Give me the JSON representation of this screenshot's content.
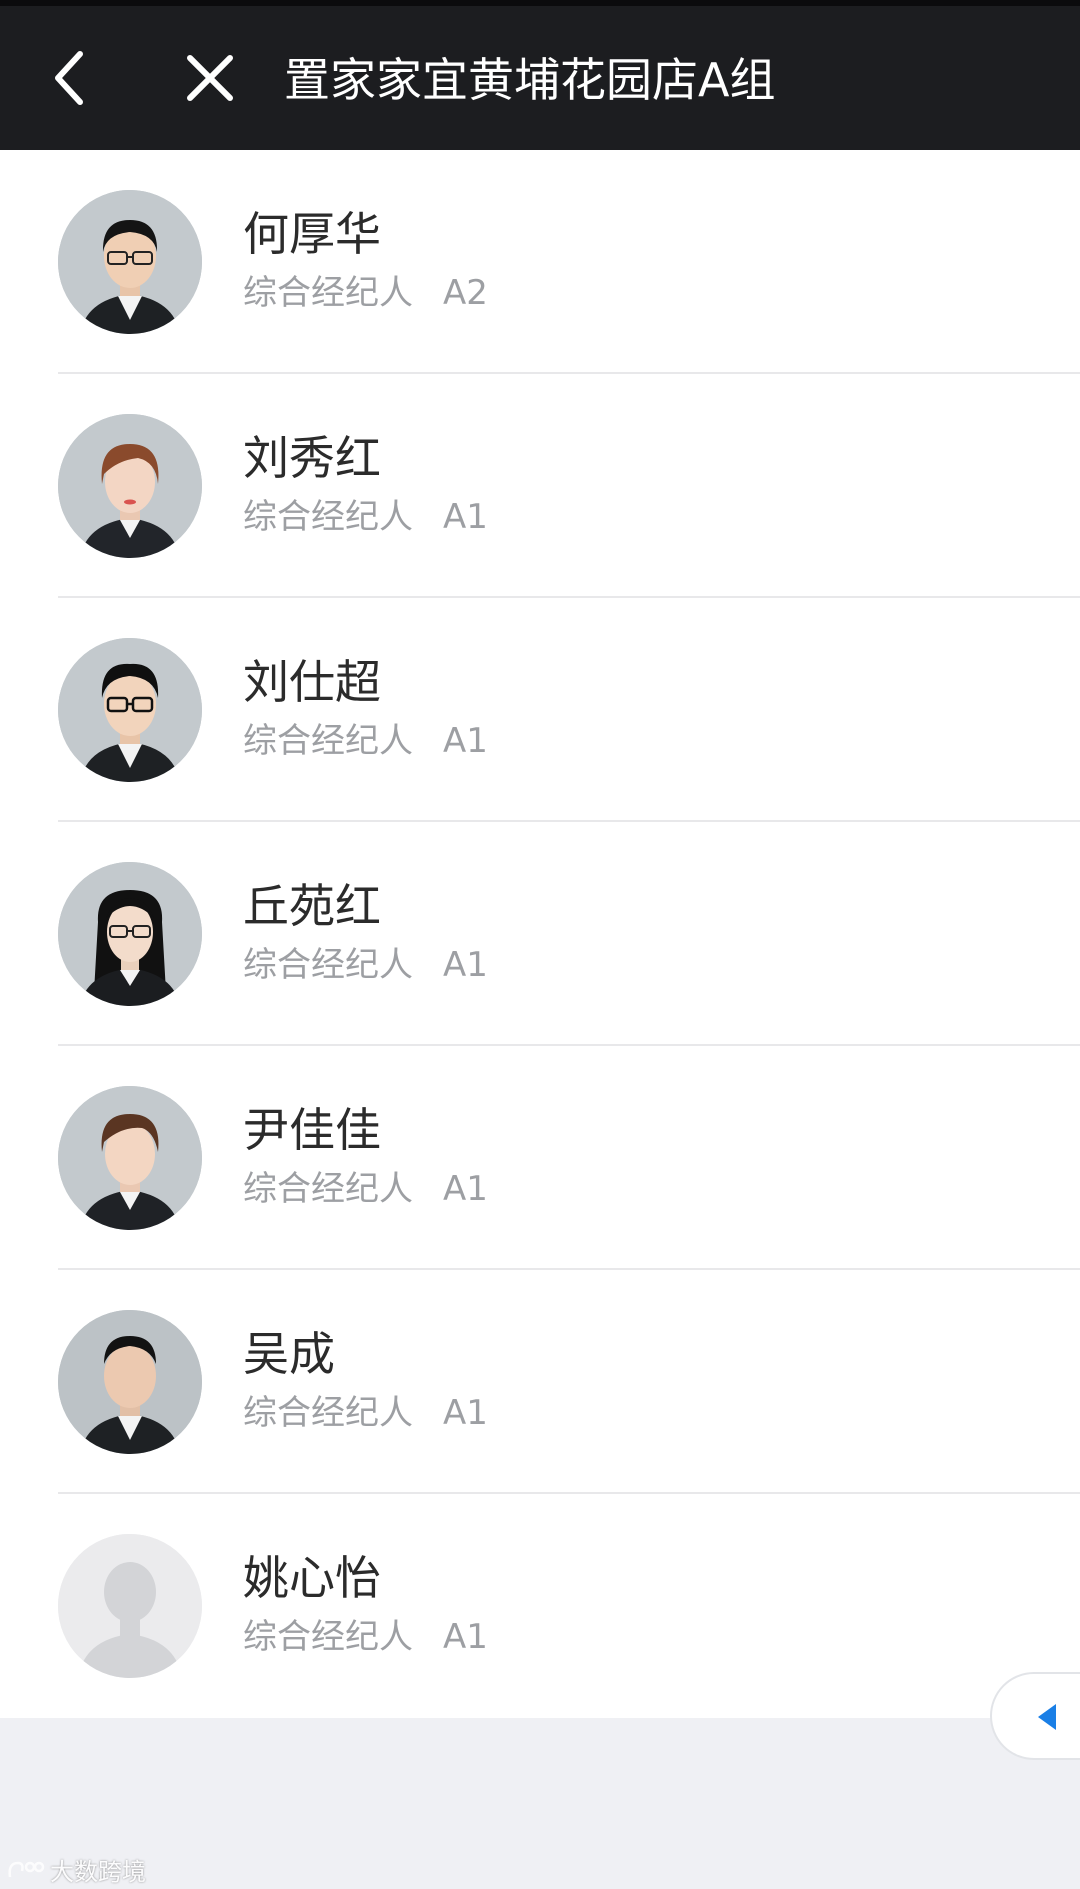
{
  "header": {
    "title": "置家家宜黄埔花园店A组",
    "back_icon": "chevron-left-icon",
    "close_icon": "close-icon",
    "background": "#1c1d20"
  },
  "members": [
    {
      "name": "何厚华",
      "role": "综合经纪人",
      "level": "A2",
      "avatar": "male-photo-glasses"
    },
    {
      "name": "刘秀红",
      "role": "综合经纪人",
      "level": "A1",
      "avatar": "female-photo-short-hair"
    },
    {
      "name": "刘仕超",
      "role": "综合经纪人",
      "level": "A1",
      "avatar": "male-photo-glasses"
    },
    {
      "name": "丘苑红",
      "role": "综合经纪人",
      "level": "A1",
      "avatar": "female-photo-glasses"
    },
    {
      "name": "尹佳佳",
      "role": "综合经纪人",
      "level": "A1",
      "avatar": "female-photo-short-hair"
    },
    {
      "name": "吴成",
      "role": "综合经纪人",
      "level": "A1",
      "avatar": "male-photo"
    },
    {
      "name": "姚心怡",
      "role": "综合经纪人",
      "level": "A1",
      "avatar": "default-avatar-placeholder"
    }
  ],
  "float_tab": {
    "icon": "triangle-left-icon",
    "color": "#1a7fe6"
  },
  "watermark": {
    "text": "大数跨境"
  }
}
